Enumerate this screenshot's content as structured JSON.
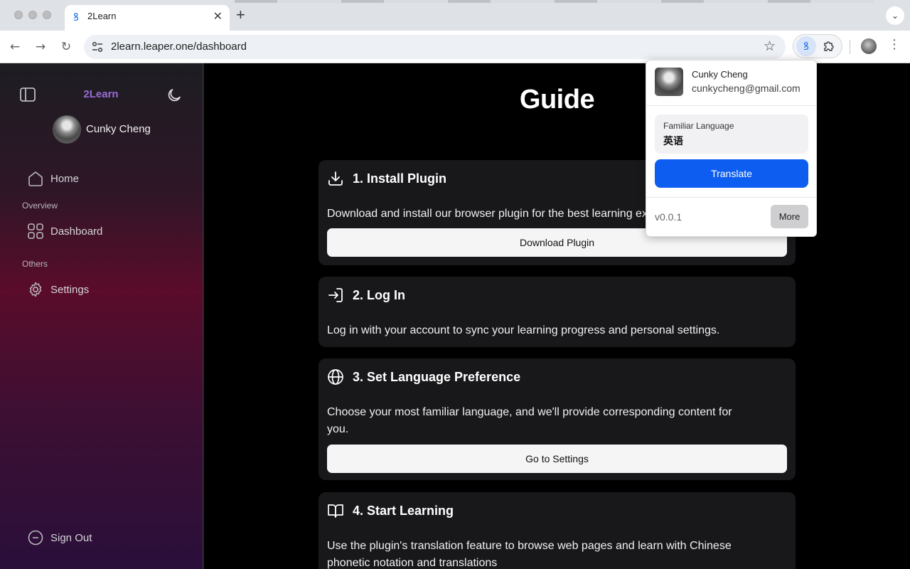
{
  "browser": {
    "tab_title": "2Learn",
    "tab_favicon": "ꝸ",
    "tab_close": "✕",
    "new_tab": "+",
    "tab_dropdown": "⌄",
    "url": "2learn.leaper.one/dashboard",
    "back": "←",
    "forward": "→",
    "reload": "↻",
    "star": "☆",
    "ext_icon": "ꝸ",
    "menu": "⋮"
  },
  "sidebar": {
    "brand": "2Learn",
    "username": "Cunky Cheng",
    "home_label": "Home",
    "overview_label": "Overview",
    "dashboard_label": "Dashboard",
    "others_label": "Others",
    "settings_label": "Settings",
    "signout_label": "Sign Out"
  },
  "main": {
    "title": "Guide",
    "cards": [
      {
        "title": "1. Install Plugin",
        "description": "Download and install our browser plugin for the best learning experience.",
        "button": "Download Plugin"
      },
      {
        "title": "2. Log In",
        "description": "Log in with your account to sync your learning progress and personal settings."
      },
      {
        "title": "3. Set Language Preference",
        "description_line1": "Choose your most familiar language, and we'll provide corresponding content for",
        "description_line2": "you.",
        "button": "Go to Settings"
      },
      {
        "title": "4. Start Learning",
        "description_line1": "Use the plugin's translation feature to browse web pages and learn with Chinese",
        "description_line2": "phonetic notation and translations"
      }
    ]
  },
  "popup": {
    "name": "Cunky Cheng",
    "email": "cunkycheng@gmail.com",
    "language_label": "Familiar Language",
    "language_value": "英语",
    "translate_button": "Translate",
    "version": "v0.0.1",
    "more_button": "More"
  },
  "colors": {
    "brand": "#9b6bd6",
    "translate_blue": "#0d5ef0"
  }
}
